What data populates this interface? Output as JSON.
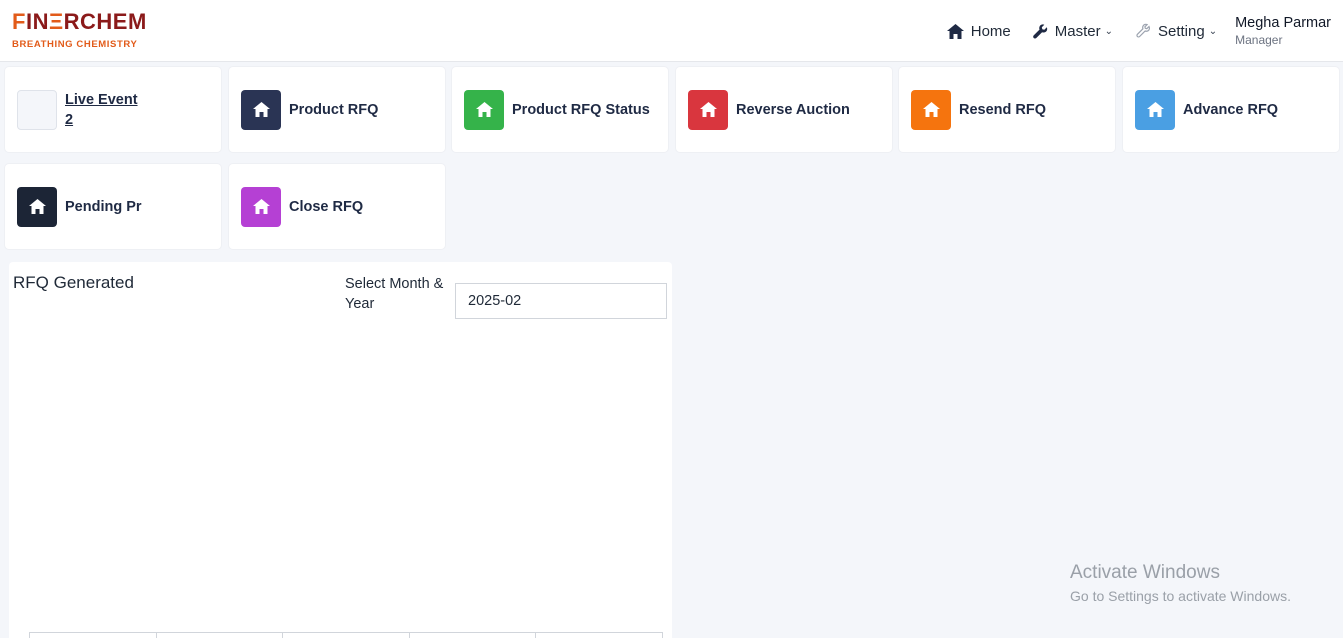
{
  "brand": {
    "name_part1": "F",
    "name_part2": "IN",
    "name_part3": "RCHEM",
    "tagline": "BREATHING CHEMISTRY"
  },
  "nav": {
    "home": "Home",
    "master": "Master",
    "setting": "Setting",
    "user_name": "Megha Parmar",
    "user_role": "Manager"
  },
  "tiles": {
    "live_event_label": "Live Event",
    "live_event_count": "2",
    "product_rfq": "Product RFQ",
    "product_rfq_status": "Product RFQ Status",
    "reverse_auction": "Reverse Auction",
    "resend_rfq": "Resend RFQ",
    "advance_rfq": "Advance RFQ",
    "pending_pr": "Pending Pr",
    "close_rfq": "Close RFQ"
  },
  "tile_colors": {
    "product_rfq": "#2a3454",
    "product_rfq_status": "#35b34a",
    "reverse_auction": "#d9363e",
    "resend_rfq": "#f5740e",
    "advance_rfq": "#4a9fe3",
    "pending_pr": "#1c2536",
    "close_rfq": "#b540d4"
  },
  "panel": {
    "title": "RFQ Generated",
    "month_label": "Select Month & Year",
    "month_value": "2025-02"
  },
  "watermark": {
    "title": "Activate Windows",
    "subtitle": "Go to Settings to activate Windows."
  }
}
